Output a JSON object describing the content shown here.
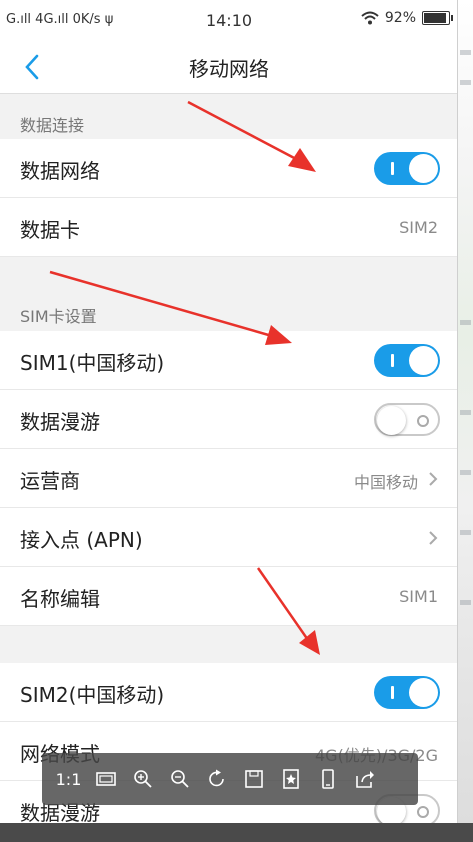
{
  "status_bar": {
    "left": "G.ıll 4G.ıll 0K/s ψ",
    "time": "14:10",
    "battery": "92%"
  },
  "header": {
    "title": "移动网络"
  },
  "sections": [
    {
      "title": "数据连接",
      "rows": [
        {
          "label": "数据网络",
          "toggle": "on"
        },
        {
          "label": "数据卡",
          "value": "SIM2"
        }
      ]
    },
    {
      "title": "SIM卡设置",
      "rows": [
        {
          "label": "SIM1(中国移动)",
          "toggle": "on"
        },
        {
          "label": "数据漫游",
          "toggle": "off"
        },
        {
          "label": "运营商",
          "value": "中国移动",
          "chevron": true
        },
        {
          "label": "接入点 (APN)",
          "chevron": true
        },
        {
          "label": "名称编辑",
          "value": "SIM1"
        }
      ]
    },
    {
      "title": "",
      "rows": [
        {
          "label": "SIM2(中国移动)",
          "toggle": "on"
        },
        {
          "label": "网络模式",
          "value": "4G(优先)/3G/2G"
        },
        {
          "label": "数据漫游",
          "toggle": "off"
        }
      ]
    }
  ],
  "viewer_toolbar": {
    "ratio_label": "1:1",
    "buttons": [
      "fit-screen-icon",
      "zoom-in-icon",
      "zoom-out-icon",
      "rotate-icon",
      "save-icon",
      "bookmark-icon",
      "phone-icon",
      "share-icon"
    ]
  },
  "colors": {
    "accent": "#1a9ce8",
    "annotation_arrow": "#e8322b"
  }
}
